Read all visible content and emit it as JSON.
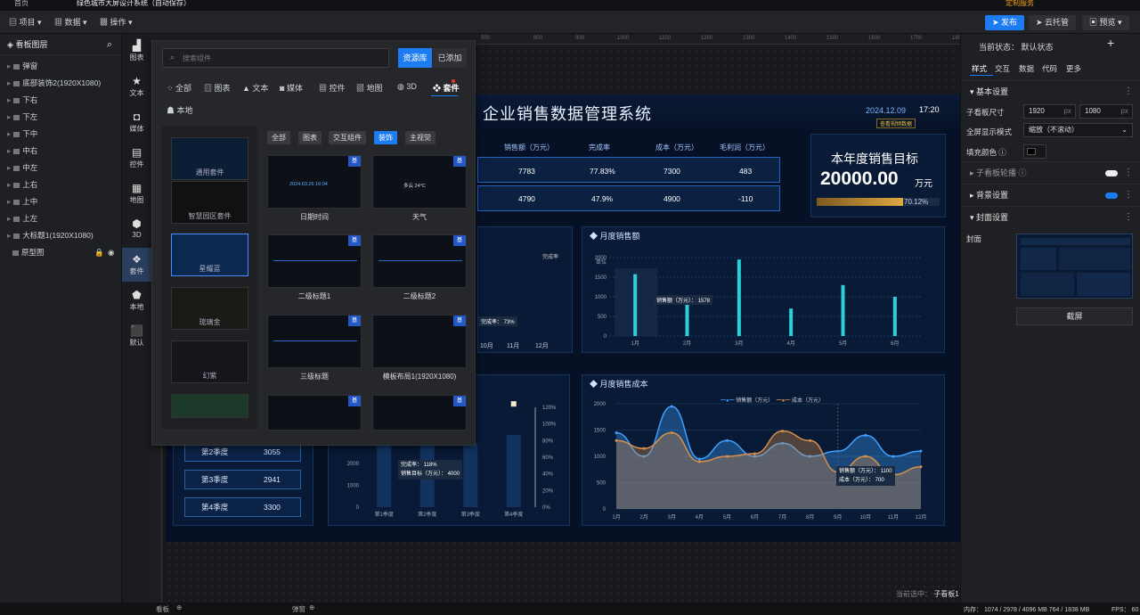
{
  "tabbar": {
    "tabs": [
      "首页",
      "绿色城市大屏设计系统（自动保存）"
    ],
    "warning": "定制服务"
  },
  "toolbar": {
    "project": "项目",
    "data": "数据",
    "ops": "操作",
    "publish": "发布",
    "cloud": "云托管",
    "preview": "预览"
  },
  "layers": {
    "title": "看板图层",
    "items": [
      "弹窗",
      "底部装饰2(1920X1080)",
      "下右",
      "下左",
      "下中",
      "中右",
      "中左",
      "上右",
      "上中",
      "上左",
      "大标题1(1920X1080)",
      "原型图"
    ]
  },
  "iconbar": {
    "items": [
      {
        "label": "图表",
        "icon": "chart-icon"
      },
      {
        "label": "文本",
        "icon": "text-icon"
      },
      {
        "label": "媒体",
        "icon": "media-icon"
      },
      {
        "label": "控件",
        "icon": "control-icon"
      },
      {
        "label": "地图",
        "icon": "map-icon"
      },
      {
        "label": "3D",
        "icon": "cube-icon"
      },
      {
        "label": "套件",
        "icon": "kit-icon"
      },
      {
        "label": "本地",
        "icon": "local-icon"
      },
      {
        "label": "默认",
        "icon": "default-icon"
      }
    ]
  },
  "ruler": {
    "ticks": [
      "500",
      "800",
      "900",
      "1000",
      "1100",
      "1200",
      "1300",
      "1400",
      "1500",
      "1600",
      "1700",
      "1800",
      "1900"
    ]
  },
  "popup": {
    "search_placeholder": "搜索组件",
    "lib_tab": "资源库",
    "added_tab": "已添加",
    "categories": [
      "全部",
      "图表",
      "文本",
      "媒体",
      "控件",
      "地图",
      "3D",
      "套件"
    ],
    "local": "本地",
    "subtabs": [
      "全部",
      "图表",
      "交互组件",
      "装饰",
      "主视觉"
    ],
    "kits": [
      "通用套件",
      "智慧园区套件",
      "星耀蓝",
      "琉璃金",
      "幻紫",
      ""
    ],
    "cards": [
      "日期时间",
      "天气",
      "二级标题1",
      "二级标题2",
      "三级标题",
      "模板布局1(1920X1080)"
    ],
    "badge": "基",
    "date_preview": "2024.03.26  16:04",
    "weather_preview": "多云  24°C"
  },
  "dashboard": {
    "title": "企业销售数据管理系统",
    "date": "2024.12.09",
    "time": "17:20",
    "tag": "查看视频数据",
    "table_headers": [
      "销售额（万元）",
      "完成率",
      "成本（万元）",
      "毛利润（万元）"
    ],
    "rows": [
      [
        "7783",
        "77.83%",
        "7300",
        "483"
      ],
      [
        "4790",
        "47.9%",
        "4900",
        "-110"
      ]
    ],
    "target_title": "本年度销售目标",
    "target_value": "20000.00",
    "target_unit": "万元",
    "target_pct": "70.12%",
    "completion_label": "完成率",
    "left_tip": "完成率：  73%",
    "left_months": [
      "10月",
      "11月",
      "12月"
    ],
    "monthly_sales_title": "月度销售额",
    "monthly_cost_title": "月度销售成本",
    "unit_label": "单位",
    "sales_tip": "销售额（万元）：  1578",
    "quarters": [
      [
        "第2季度",
        "3055"
      ],
      [
        "第3季度",
        "2941"
      ],
      [
        "第4季度",
        "3300"
      ]
    ],
    "q_tip1": "完成率：  118%",
    "q_tip2": "销售目标（万元）：  4000",
    "q_x": [
      "第1季度",
      "第2季度",
      "第3季度",
      "第4季度"
    ],
    "legend_cost": [
      "销售额（万元）",
      "成本（万元）"
    ],
    "cost_tip1": "销售额（万元）：  1100",
    "cost_tip2": "成本（万元）：  700"
  },
  "chart_data": [
    {
      "type": "bar",
      "title": "月度销售额",
      "categories": [
        "1月",
        "2月",
        "3月",
        "4月",
        "5月",
        "6月"
      ],
      "values": [
        1578,
        800,
        1950,
        700,
        1300,
        1000
      ],
      "ylim": [
        0,
        2000
      ],
      "yticks": [
        "0",
        "500",
        "1000",
        "1500",
        "2000"
      ]
    },
    {
      "type": "line",
      "title": "月度销售成本",
      "categories": [
        "1月",
        "2月",
        "3月",
        "4月",
        "5月",
        "6月",
        "7月",
        "8月",
        "9月",
        "10月",
        "11月",
        "12月"
      ],
      "series": [
        {
          "name": "销售额（万元）",
          "values": [
            1450,
            1000,
            1950,
            950,
            1300,
            1000,
            1250,
            1000,
            1100,
            1400,
            1000,
            1100
          ]
        },
        {
          "name": "成本（万元）",
          "values": [
            1300,
            1150,
            1450,
            900,
            1000,
            1050,
            1480,
            1300,
            700,
            1000,
            650,
            800
          ]
        }
      ],
      "ylim": [
        0,
        2000
      ],
      "yticks": [
        "0",
        "500",
        "1000",
        "1500",
        "2000"
      ]
    },
    {
      "type": "bar",
      "title": "季度",
      "categories": [
        "第1季度",
        "第2季度",
        "第3季度",
        "第4季度"
      ],
      "values": [
        3200,
        3055,
        2941,
        3300
      ],
      "ylim": [
        0,
        4000
      ],
      "yticks": [
        "0",
        "1000",
        "2000",
        "3000",
        "4000"
      ],
      "y2ticks": [
        "0%",
        "20%",
        "40%",
        "60%",
        "80%",
        "100%",
        "120%"
      ]
    }
  ],
  "rpanel": {
    "state": "当前状态：  默认状态",
    "tabs": [
      "样式",
      "交互",
      "数据",
      "代码",
      "更多"
    ],
    "basic": "基本设置",
    "size_label": "子看板尺寸",
    "w": "1920",
    "h": "1080",
    "px": "px",
    "fullscreen_label": "全屏显示模式",
    "fullscreen_val": "缩放（不滚动）",
    "fill_label": "填充颜色",
    "carousel": "子看板轮播",
    "bg": "背景设置",
    "cover": "封面设置",
    "cover_label": "封面",
    "screenshot": "截屏"
  },
  "bottom": {
    "left": "看板",
    "right_tab": "弹窗",
    "current": "当前选中：",
    "current_val": "子看板1",
    "mem": "内存：  1074 / 2978 / 4096 MB  764 / 1838 MB",
    "fps": "FPS：  60"
  }
}
